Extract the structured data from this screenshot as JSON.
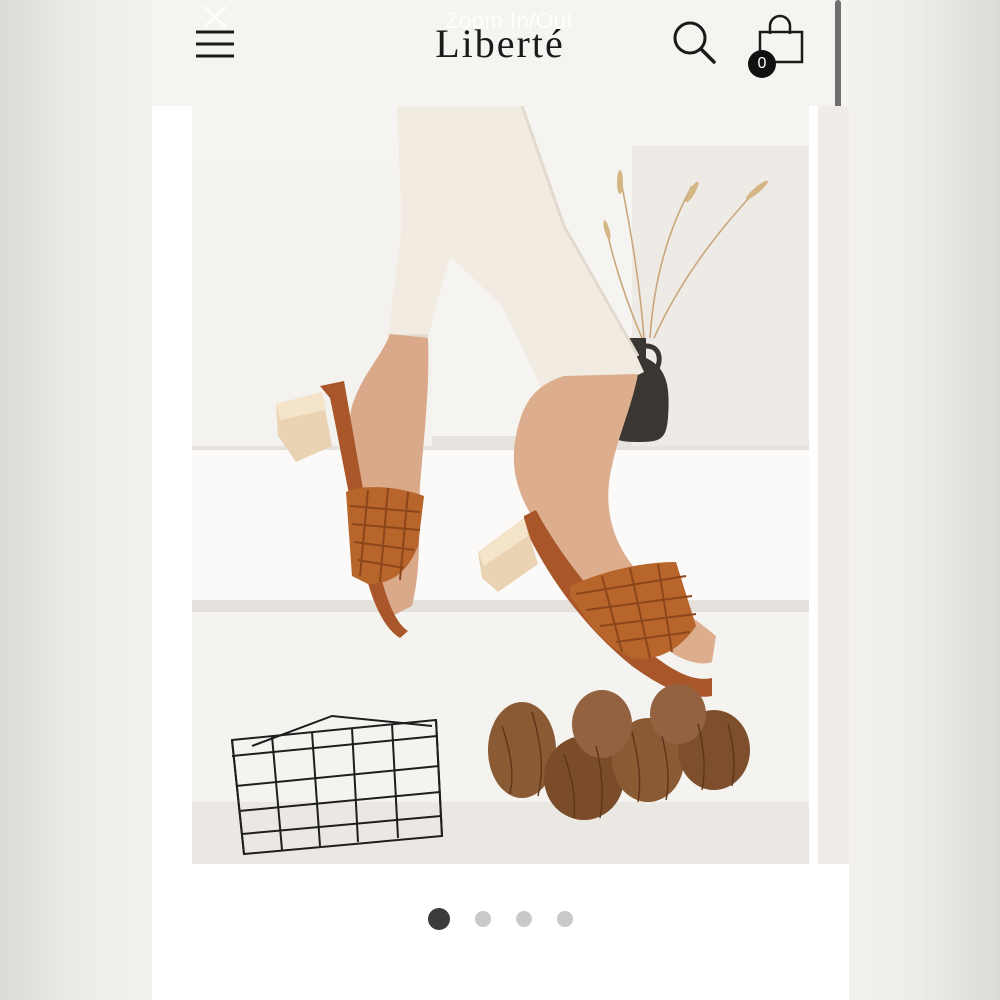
{
  "header": {
    "logo": "Liberté",
    "zoom_label": "Zoom In/Out",
    "cart_count": "0"
  },
  "icons": {
    "menu": "hamburger-menu-icon",
    "close": "close-icon",
    "search": "search-icon",
    "cart": "shopping-bag-icon"
  },
  "gallery": {
    "slide_count": 4,
    "active_slide": 1
  },
  "colors": {
    "header_bg": "#f5f4f1",
    "logo": "#1a1a1a",
    "dot_active": "#3b3b3b",
    "dot_inactive": "#c9c9c9",
    "sandal_tan": "#b7652a"
  }
}
